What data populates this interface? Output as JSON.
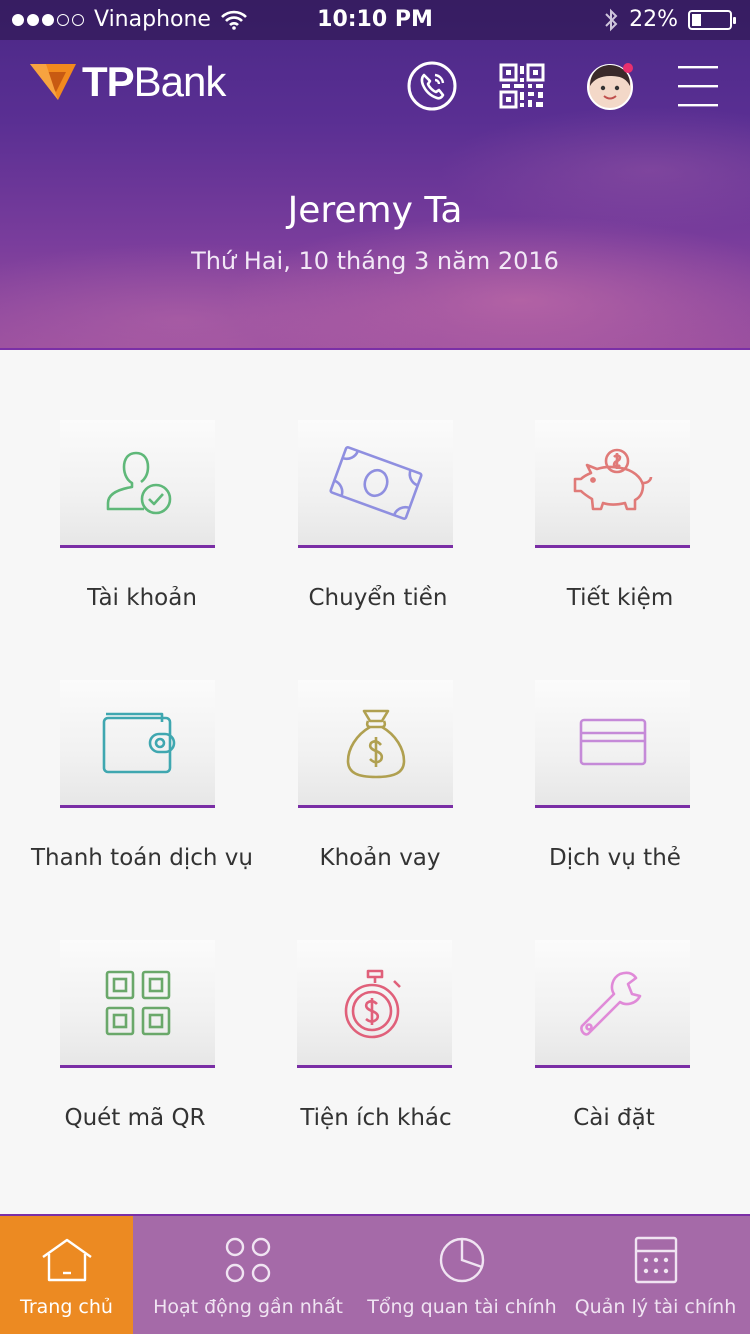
{
  "status_bar": {
    "carrier": "Vinaphone",
    "time": "10:10 PM",
    "battery": "22%"
  },
  "brand": {
    "logo_bold": "TP",
    "logo_regular": "Bank"
  },
  "header": {
    "icons": [
      "phone-icon",
      "qr-code-icon",
      "avatar",
      "menu-icon"
    ]
  },
  "user": {
    "name": "Jeremy Ta",
    "date": "Thứ Hai, 10 tháng 3 năm 2016"
  },
  "menu": [
    {
      "label": "Tài khoản",
      "icon": "account-user-check-icon",
      "color": "#5fb879"
    },
    {
      "label": "Chuyển tiền",
      "icon": "money-bill-icon",
      "color": "#8f8fe0"
    },
    {
      "label": "Tiết kiệm",
      "icon": "piggy-bank-icon",
      "color": "#e07a78"
    },
    {
      "label": "Thanh toán dịch vụ",
      "icon": "wallet-icon",
      "color": "#3fa7b0"
    },
    {
      "label": "Khoản vay",
      "icon": "money-bag-icon",
      "color": "#b0a050"
    },
    {
      "label": "Dịch vụ thẻ",
      "icon": "credit-card-icon",
      "color": "#c58ad8"
    },
    {
      "label": "Quét mã QR",
      "icon": "qr-scan-icon",
      "color": "#6aa86a"
    },
    {
      "label": "Tiện ích khác",
      "icon": "stopwatch-dollar-icon",
      "color": "#e0607a"
    },
    {
      "label": "Cài đặt",
      "icon": "wrench-icon",
      "color": "#e08ad8"
    }
  ],
  "tabs": [
    {
      "label": "Trang chủ",
      "icon": "home-icon",
      "active": true
    },
    {
      "label": "Hoạt động gần nhất",
      "icon": "recent-activity-icon",
      "active": false
    },
    {
      "label": "Tổng quan tài chính",
      "icon": "pie-chart-icon",
      "active": false
    },
    {
      "label": "Quản lý tài chính",
      "icon": "calculator-icon",
      "active": false
    }
  ],
  "colors": {
    "accent_purple": "#7a2ea5",
    "tab_active": "#ec8a22",
    "tab_bar": "#a56aa8"
  }
}
